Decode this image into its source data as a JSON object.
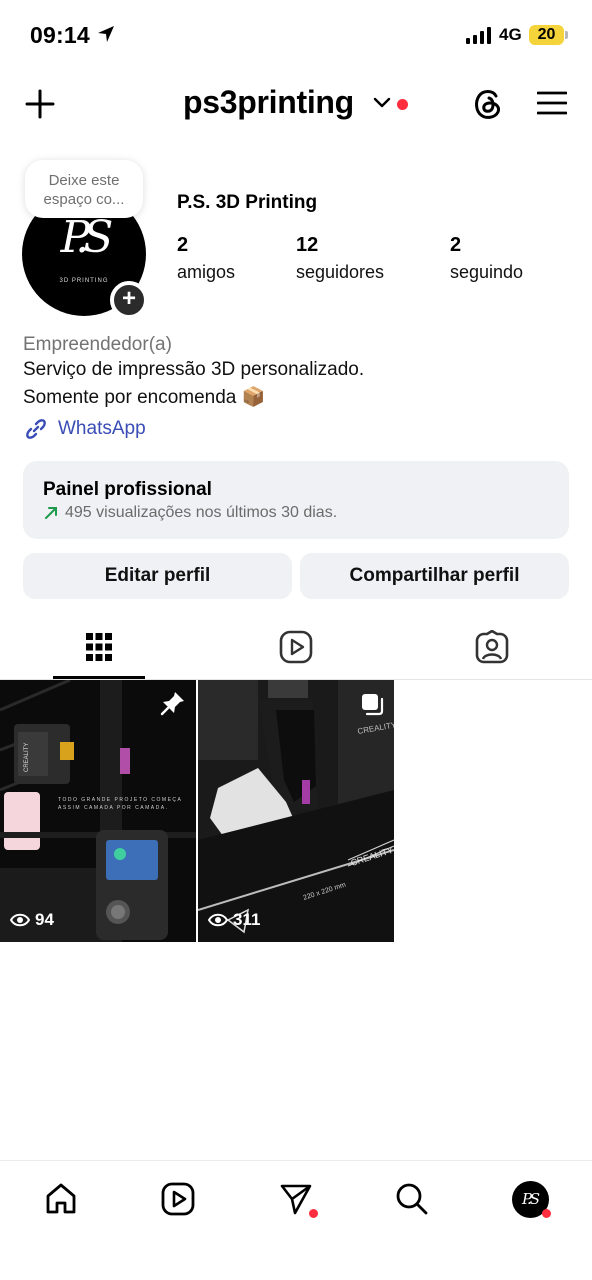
{
  "status_bar": {
    "time": "09:14",
    "network": "4G",
    "battery": "20"
  },
  "header": {
    "username": "ps3printing"
  },
  "profile": {
    "note": "Deixe este espaço co...",
    "avatar_monogram": "P.S",
    "avatar_subtitle": "3D PRINTING",
    "display_name": "P.S. 3D Printing",
    "stats": [
      {
        "value": "2",
        "label": "amigos"
      },
      {
        "value": "12",
        "label": "seguidores"
      },
      {
        "value": "2",
        "label": "seguindo"
      }
    ],
    "category": "Empreendedor(a)",
    "bio_line1": "Serviço de impressão 3D personalizado.",
    "bio_line2": "Somente por encomenda 📦",
    "link_label": "WhatsApp"
  },
  "dashboard": {
    "title": "Painel profissional",
    "subtitle": "495 visualizações nos últimos 30 dias."
  },
  "buttons": {
    "edit": "Editar perfil",
    "share": "Compartilhar perfil"
  },
  "tabs": [
    "posts-grid",
    "reels",
    "tagged"
  ],
  "posts": [
    {
      "views": "94",
      "caption": "TODO GRANDE PROJETO COMEÇA ASSIM CAMADA POR CAMADA.",
      "brand": "CREALITY",
      "pinned": true
    },
    {
      "views": "311",
      "brand": "CREALITY",
      "bed_label": "220 x 220 mm",
      "multiple": true
    }
  ],
  "colors": {
    "accent_red": "#ff2d3d",
    "link_blue": "#3a4cb5",
    "panel_gray": "#eff1f4",
    "battery_yellow": "#f5d33b",
    "trend_green": "#1e9a4c"
  },
  "icons": [
    "location-arrow-icon",
    "plus-icon",
    "chevron-down-icon",
    "threads-icon",
    "menu-icon",
    "link-icon",
    "trend-up-icon",
    "grid-icon",
    "reels-icon",
    "tagged-icon",
    "pin-icon",
    "eye-icon",
    "home-icon",
    "reels-nav-icon",
    "send-icon",
    "search-icon"
  ]
}
